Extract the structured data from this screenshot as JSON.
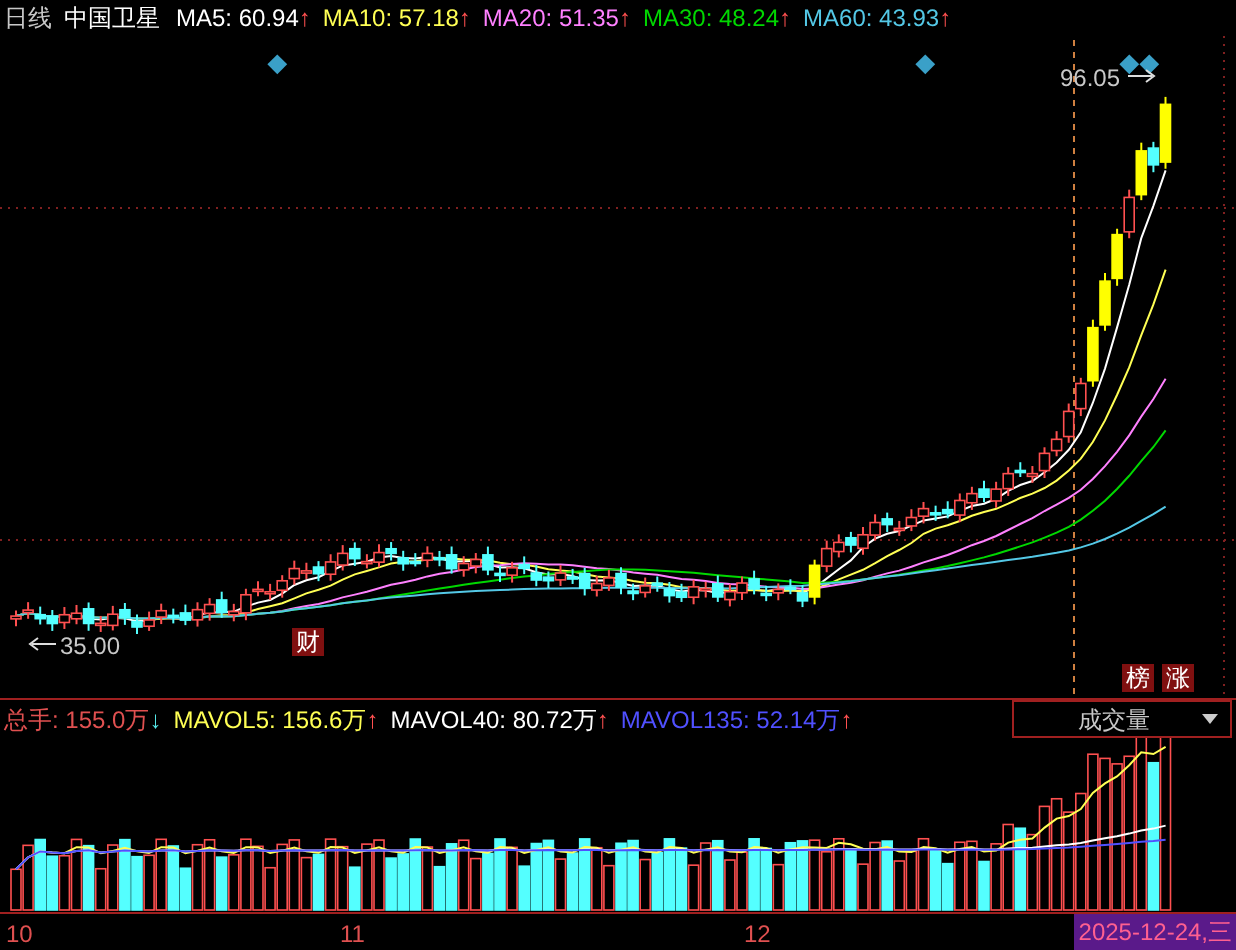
{
  "header": {
    "period": "日线",
    "name": "中国卫星",
    "indicators": [
      {
        "label": "MA5: 60.94",
        "arrow": "↑",
        "rising": true,
        "color": "#ffffff"
      },
      {
        "label": "MA10: 57.18",
        "arrow": "↑",
        "rising": true,
        "color": "#ffff54"
      },
      {
        "label": "MA20: 51.35",
        "arrow": "↑",
        "rising": true,
        "color": "#ff80ff"
      },
      {
        "label": "MA30: 48.24",
        "arrow": "↑",
        "rising": true,
        "color": "#00d800"
      },
      {
        "label": "MA60: 43.93",
        "arrow": "↑",
        "rising": true,
        "color": "#54c8e6"
      }
    ]
  },
  "price_labels": {
    "high": "96.05",
    "low": "35.00"
  },
  "event_markers": [
    {
      "text": "财"
    },
    {
      "text": "榜"
    },
    {
      "text": "涨"
    }
  ],
  "volume": {
    "indicators": [
      {
        "label": "总手: 155.0万",
        "arrow": "↓",
        "rising": false,
        "color": "#e05050"
      },
      {
        "label": "MAVOL5: 156.6万",
        "arrow": "↑",
        "rising": true,
        "color": "#ffff54"
      },
      {
        "label": "MAVOL40: 80.72万",
        "arrow": "↑",
        "rising": true,
        "color": "#ffffff"
      },
      {
        "label": "MAVOL135: 52.14万",
        "arrow": "↑",
        "rising": true,
        "color": "#5050ff"
      }
    ],
    "selector": "成交量"
  },
  "x_axis": {
    "labels": [
      "10",
      "11",
      "12"
    ],
    "current_date": "2025-12-24,三"
  }
}
